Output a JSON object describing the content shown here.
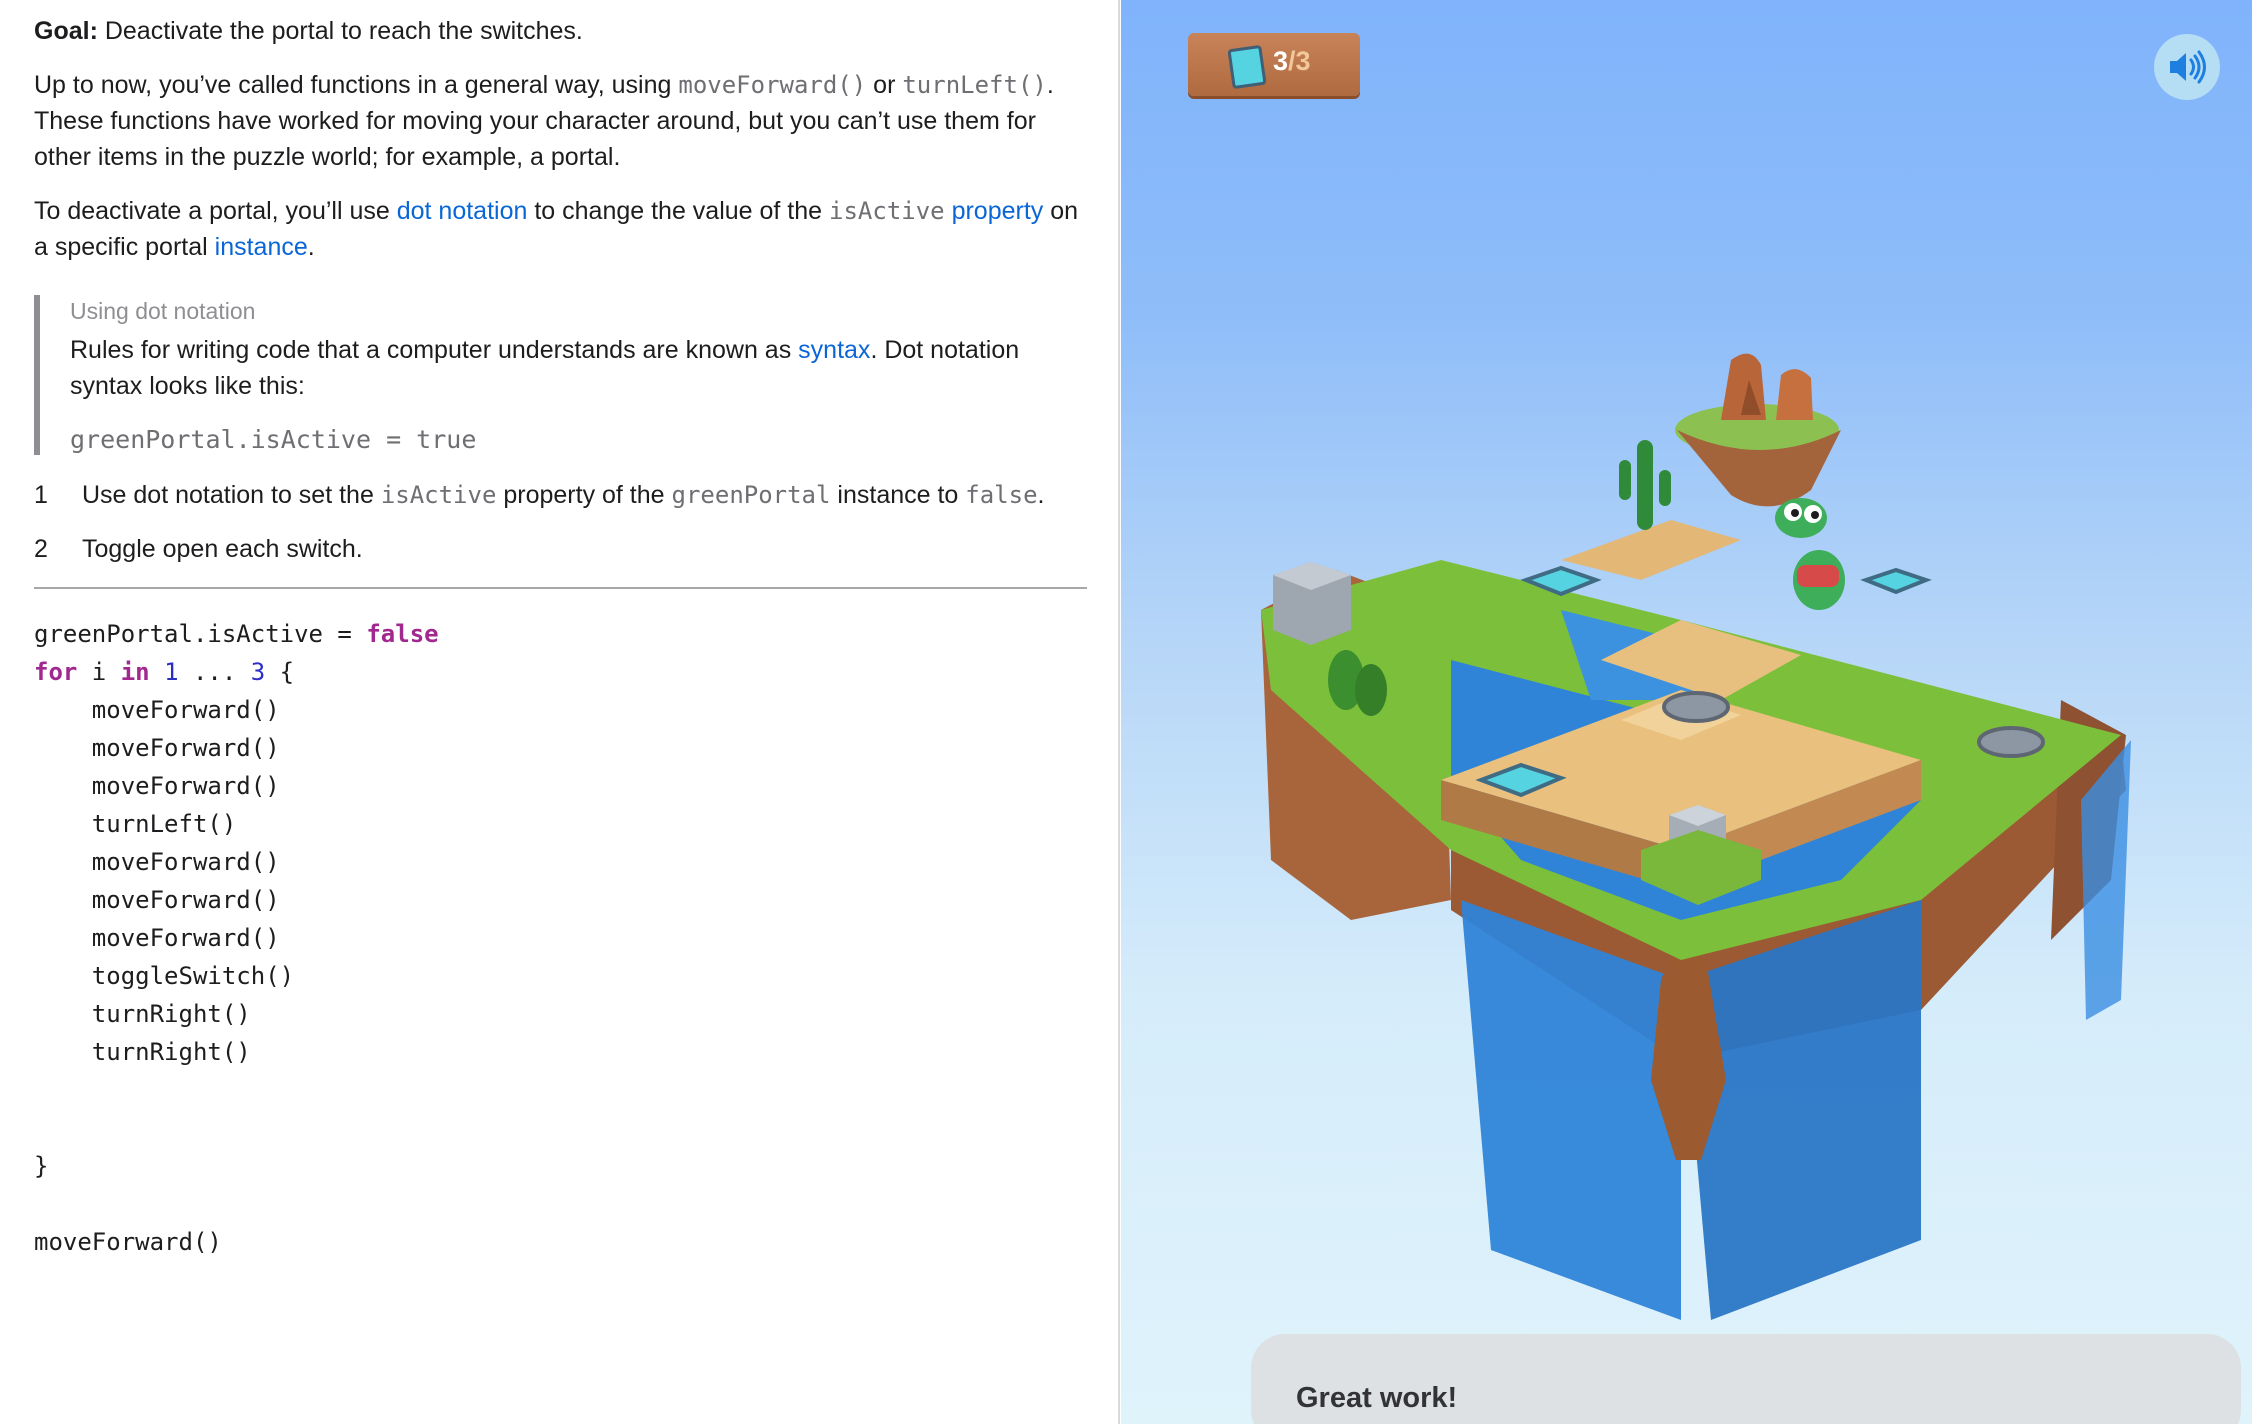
{
  "instructions": {
    "goal_label": "Goal:",
    "goal_text": " Deactivate the portal to reach the switches.",
    "para1": {
      "t1": "Up to now, you’ve called functions in a general way, using ",
      "c1": "moveForward()",
      "t2": " or ",
      "c2": "turnLeft()",
      "t3": ". These functions have worked for moving your character around, but you can’t use them for other items in the puzzle world; for example, a portal."
    },
    "para2": {
      "t1": "To deactivate a portal, you’ll use ",
      "link1": "dot notation",
      "t2": " to change the value of the ",
      "c1": "isActive",
      "link2": "property",
      "t3": " on a specific portal ",
      "link3": "instance",
      "t4": "."
    },
    "callout": {
      "title": "Using dot notation",
      "t1": "Rules for writing code that a computer understands are known as ",
      "link": "syntax",
      "t2": ". Dot notation syntax looks like this:",
      "code": "greenPortal.isActive = true"
    },
    "steps": [
      {
        "number": "1",
        "t1": "Use dot notation to set the ",
        "c1": "isActive",
        "t2": " property of the ",
        "c2": "greenPortal",
        "t3": " instance to ",
        "c3": "false",
        "t4": "."
      },
      {
        "number": "2",
        "text": "Toggle open each switch."
      }
    ]
  },
  "editor": {
    "line1": {
      "a": "greenPortal.isActive = ",
      "kw": "false"
    },
    "line2": {
      "kw1": "for",
      "a": " i ",
      "kw2": "in",
      "sp": " ",
      "n1": "1",
      "b": " ... ",
      "n2": "3",
      "c": " {"
    },
    "body": [
      "    moveForward()",
      "    moveForward()",
      "    moveForward()",
      "    turnLeft()",
      "    moveForward()",
      "    moveForward()",
      "    moveForward()",
      "    toggleSwitch()",
      "    turnRight()",
      "    turnRight()"
    ],
    "close": "}",
    "after": "moveForward()"
  },
  "game": {
    "counter": {
      "current": "3",
      "sep": "/",
      "total": "3"
    },
    "toast": "Great work!",
    "icons": {
      "badge": "gem-icon",
      "sound": "speaker-icon"
    },
    "colors": {
      "sky_top": "#7fb3fb",
      "sky_bottom": "#dff3fb",
      "water": "#2f84d8",
      "portal": "#55d3e0"
    }
  }
}
